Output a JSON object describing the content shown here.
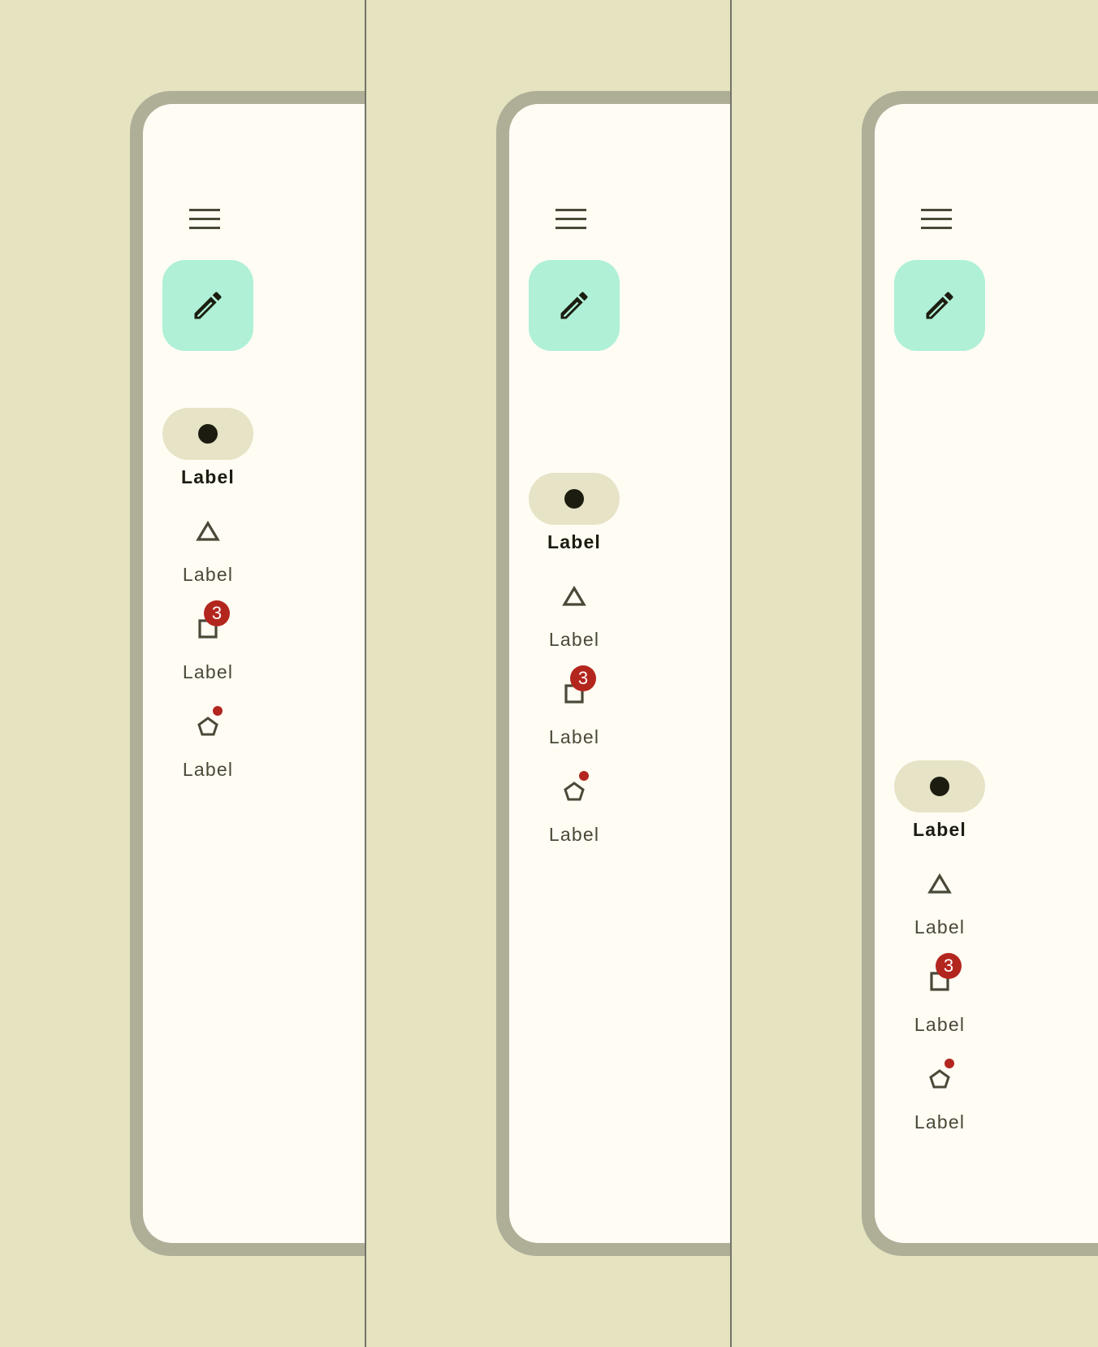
{
  "colors": {
    "background": "#E5E3C0",
    "device_frame": "#AFAF98",
    "screen": "#FFFCF4",
    "fab": "#AFF0D7",
    "active_indicator": "#E6E3C6",
    "badge": "#B3261E",
    "icon": "#4A4837",
    "active_icon": "#1C1D10"
  },
  "panels": [
    {
      "alignment": "top",
      "menu_icon": "menu-icon",
      "fab_icon": "edit-pencil-icon",
      "nav_items": [
        {
          "label": "Label",
          "icon": "circle-icon",
          "active": true,
          "badge": ""
        },
        {
          "label": "Label",
          "icon": "triangle-icon",
          "active": false,
          "badge": ""
        },
        {
          "label": "Label",
          "icon": "square-icon",
          "active": false,
          "badge": "3"
        },
        {
          "label": "Label",
          "icon": "pentagon-icon",
          "active": false,
          "badge": "dot"
        }
      ]
    },
    {
      "alignment": "center",
      "menu_icon": "menu-icon",
      "fab_icon": "edit-pencil-icon",
      "nav_items": [
        {
          "label": "Label",
          "icon": "circle-icon",
          "active": true,
          "badge": ""
        },
        {
          "label": "Label",
          "icon": "triangle-icon",
          "active": false,
          "badge": ""
        },
        {
          "label": "Label",
          "icon": "square-icon",
          "active": false,
          "badge": "3"
        },
        {
          "label": "Label",
          "icon": "pentagon-icon",
          "active": false,
          "badge": "dot"
        }
      ]
    },
    {
      "alignment": "bottom",
      "menu_icon": "menu-icon",
      "fab_icon": "edit-pencil-icon",
      "nav_items": [
        {
          "label": "Label",
          "icon": "circle-icon",
          "active": true,
          "badge": ""
        },
        {
          "label": "Label",
          "icon": "triangle-icon",
          "active": false,
          "badge": ""
        },
        {
          "label": "Label",
          "icon": "square-icon",
          "active": false,
          "badge": "3"
        },
        {
          "label": "Label",
          "icon": "pentagon-icon",
          "active": false,
          "badge": "dot"
        }
      ]
    }
  ]
}
